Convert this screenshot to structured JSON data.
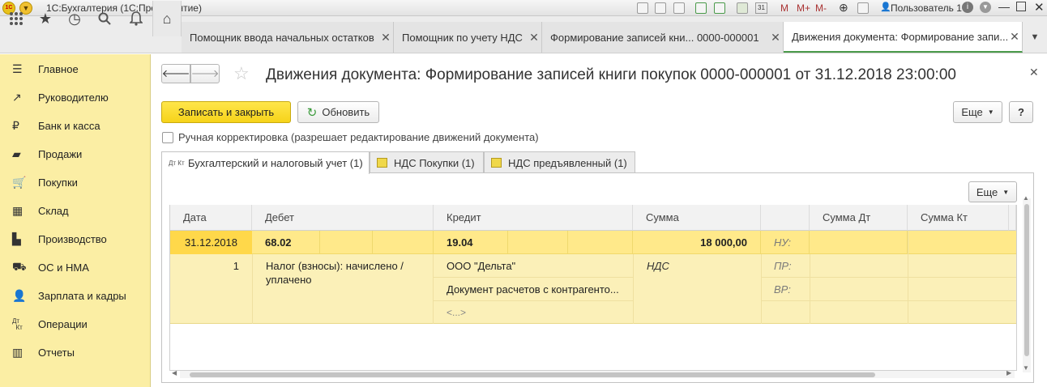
{
  "titlebar": {
    "app_title": "1С:Бухгалтерия  (1С:Предприятие)",
    "user": "Пользователь 1",
    "m": "M",
    "mplus": "M+",
    "mminus": "M-",
    "cal": "31"
  },
  "tabs": [
    {
      "label": "Помощник ввода начальных остатков"
    },
    {
      "label": "Помощник по учету НДС"
    },
    {
      "label": "Формирование записей кни...   0000-000001"
    },
    {
      "label": "Движения документа: Формирование запи..."
    }
  ],
  "sidebar": {
    "items": [
      {
        "label": "Главное",
        "icon": "menu-lines-icon"
      },
      {
        "label": "Руководителю",
        "icon": "trend-icon"
      },
      {
        "label": "Банк и касса",
        "icon": "ruble-icon"
      },
      {
        "label": "Продажи",
        "icon": "bag-icon"
      },
      {
        "label": "Покупки",
        "icon": "cart-icon"
      },
      {
        "label": "Склад",
        "icon": "grid-icon"
      },
      {
        "label": "Производство",
        "icon": "factory-icon"
      },
      {
        "label": "ОС и НМА",
        "icon": "truck-icon"
      },
      {
        "label": "Зарплата и кадры",
        "icon": "people-icon"
      },
      {
        "label": "Операции",
        "icon": "dtkt-icon"
      },
      {
        "label": "Отчеты",
        "icon": "bar-chart-icon"
      }
    ]
  },
  "doc": {
    "title": "Движения документа: Формирование записей книги покупок 0000-000001 от 31.12.2018 23:00:00",
    "save_close": "Записать и закрыть",
    "refresh": "Обновить",
    "more": "Еще",
    "help": "?",
    "manual_label": "Ручная корректировка (разрешает редактирование движений документа)"
  },
  "doctabs": [
    {
      "label": "Бухгалтерский и налоговый учет (1)",
      "icon_text": "Дт Кт"
    },
    {
      "label": "НДС Покупки (1)"
    },
    {
      "label": "НДС предъявленный (1)"
    }
  ],
  "table": {
    "more": "Еще",
    "headers": {
      "date": "Дата",
      "debit": "Дебет",
      "credit": "Кредит",
      "sum": "Сумма",
      "sum_dt": "Сумма Дт",
      "sum_kt": "Сумма Кт"
    },
    "row": {
      "date": "31.12.2018",
      "debit": "68.02",
      "credit": "19.04",
      "sum": "18 000,00",
      "nu": "НУ:",
      "pr": "ПР:",
      "vr": "ВР:",
      "num": "1",
      "debit_sub": "Налог (взносы): начислено / уплачено",
      "credit_sub1": "ООО \"Дельта\"",
      "credit_sub2": "Документ расчетов с контрагенто...",
      "credit_sub3": "<...>",
      "sum_sub": "НДС"
    }
  }
}
